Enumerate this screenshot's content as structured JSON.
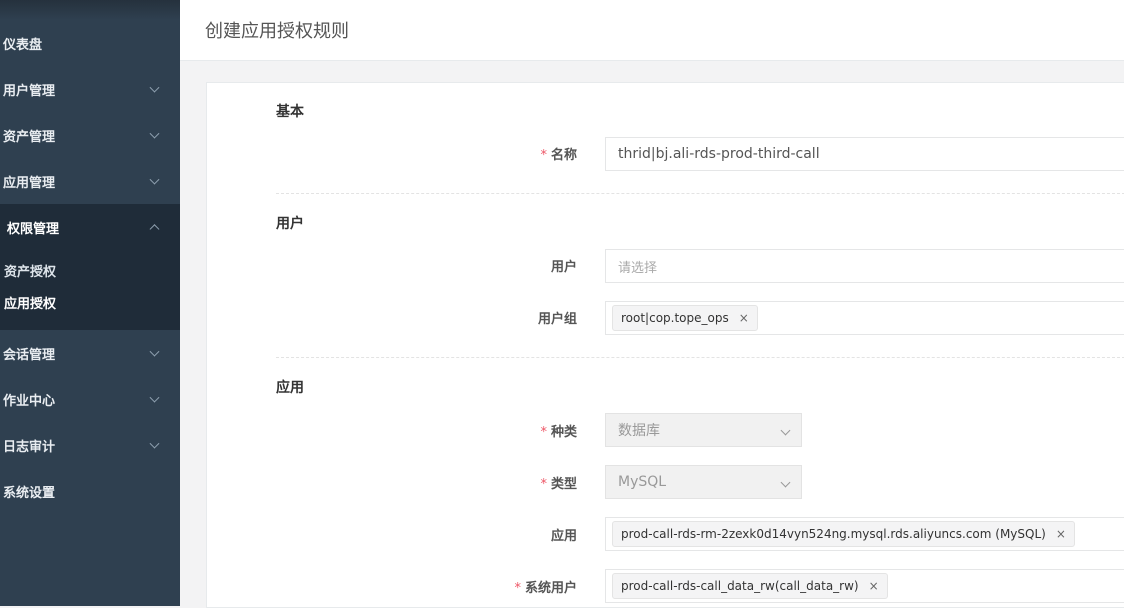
{
  "sidebar": {
    "items": [
      {
        "label": "仪表盘"
      },
      {
        "label": "用户管理"
      },
      {
        "label": "资产管理"
      },
      {
        "label": "应用管理"
      },
      {
        "label": "权限管理"
      },
      {
        "label": "会话管理"
      },
      {
        "label": "作业中心"
      },
      {
        "label": "日志审计"
      },
      {
        "label": "系统设置"
      }
    ],
    "submenu": [
      {
        "label": "资产授权"
      },
      {
        "label": "应用授权"
      }
    ]
  },
  "header": {
    "title": "创建应用授权规则"
  },
  "form": {
    "sections": {
      "basic": "基本",
      "user": "用户",
      "app": "应用"
    },
    "name": {
      "label": "名称",
      "value": "thrid|bj.ali-rds-prod-third-call"
    },
    "users": {
      "label": "用户",
      "placeholder": "请选择"
    },
    "user_groups": {
      "label": "用户组",
      "tags": [
        "root|cop.tope_ops"
      ]
    },
    "category": {
      "label": "种类",
      "value": "数据库"
    },
    "type": {
      "label": "类型",
      "value": "MySQL"
    },
    "apps": {
      "label": "应用",
      "tags": [
        "prod-call-rds-rm-2zexk0d14vyn524ng.mysql.rds.aliyuncs.com (MySQL)"
      ]
    },
    "system_users": {
      "label": "系统用户",
      "tags": [
        "prod-call-rds-call_data_rw(call_data_rw)"
      ]
    },
    "required_mark": "*",
    "tag_remove": "×"
  }
}
